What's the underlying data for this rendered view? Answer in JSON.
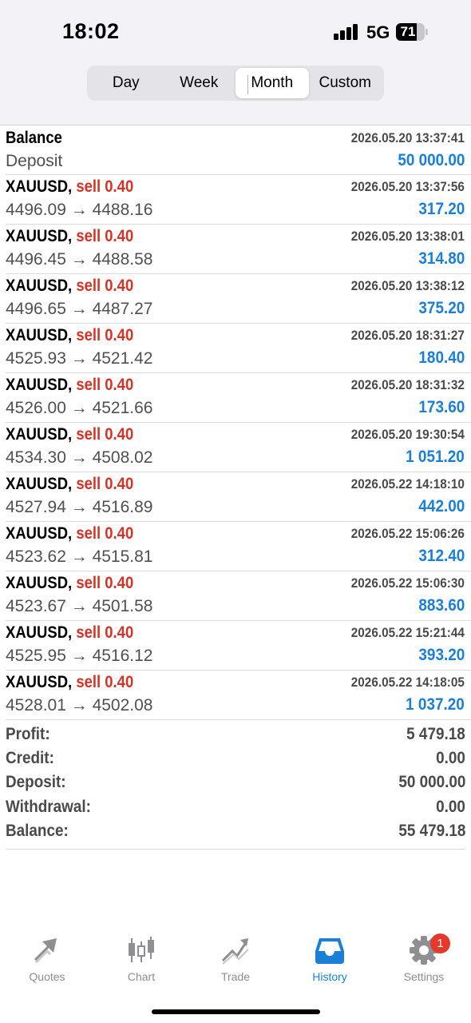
{
  "status": {
    "time": "18:02",
    "network": "5G",
    "battery": "71"
  },
  "periods": {
    "day": "Day",
    "week": "Week",
    "month": "Month",
    "custom": "Custom",
    "selected": "Month"
  },
  "balance_row": {
    "title": "Balance",
    "subtitle": "Deposit",
    "date": "2026.05.20 13:37:41",
    "amount": "50 000.00"
  },
  "deals": [
    {
      "symbol": "XAUUSD,",
      "side": "sell 0.40",
      "prices": "4496.09 → 4488.16",
      "date": "2026.05.20 13:37:56",
      "profit": "317.20"
    },
    {
      "symbol": "XAUUSD,",
      "side": "sell 0.40",
      "prices": "4496.45 → 4488.58",
      "date": "2026.05.20 13:38:01",
      "profit": "314.80"
    },
    {
      "symbol": "XAUUSD,",
      "side": "sell 0.40",
      "prices": "4496.65 → 4487.27",
      "date": "2026.05.20 13:38:12",
      "profit": "375.20"
    },
    {
      "symbol": "XAUUSD,",
      "side": "sell 0.40",
      "prices": "4525.93 → 4521.42",
      "date": "2026.05.20 18:31:27",
      "profit": "180.40"
    },
    {
      "symbol": "XAUUSD,",
      "side": "sell 0.40",
      "prices": "4526.00 → 4521.66",
      "date": "2026.05.20 18:31:32",
      "profit": "173.60"
    },
    {
      "symbol": "XAUUSD,",
      "side": "sell 0.40",
      "prices": "4534.30 → 4508.02",
      "date": "2026.05.20 19:30:54",
      "profit": "1 051.20"
    },
    {
      "symbol": "XAUUSD,",
      "side": "sell 0.40",
      "prices": "4527.94 → 4516.89",
      "date": "2026.05.22 14:18:10",
      "profit": "442.00"
    },
    {
      "symbol": "XAUUSD,",
      "side": "sell 0.40",
      "prices": "4523.62 → 4515.81",
      "date": "2026.05.22 15:06:26",
      "profit": "312.40"
    },
    {
      "symbol": "XAUUSD,",
      "side": "sell 0.40",
      "prices": "4523.67 → 4501.58",
      "date": "2026.05.22 15:06:30",
      "profit": "883.60"
    },
    {
      "symbol": "XAUUSD,",
      "side": "sell 0.40",
      "prices": "4525.95 → 4516.12",
      "date": "2026.05.22 15:21:44",
      "profit": "393.20"
    },
    {
      "symbol": "XAUUSD,",
      "side": "sell 0.40",
      "prices": "4528.01 → 4502.08",
      "date": "2026.05.22 14:18:05",
      "profit": "1 037.20"
    }
  ],
  "summary": [
    {
      "label": "Profit:",
      "value": "5 479.18"
    },
    {
      "label": "Credit:",
      "value": "0.00"
    },
    {
      "label": "Deposit:",
      "value": "50 000.00"
    },
    {
      "label": "Withdrawal:",
      "value": "0.00"
    },
    {
      "label": "Balance:",
      "value": "55 479.18"
    }
  ],
  "tabs": {
    "quotes": "Quotes",
    "chart": "Chart",
    "trade": "Trade",
    "history": "History",
    "settings": "Settings",
    "settings_badge": "1",
    "active": "History"
  },
  "colors": {
    "accent": "#1a7fd8",
    "sell": "#d63226",
    "badge": "#e5392b"
  }
}
